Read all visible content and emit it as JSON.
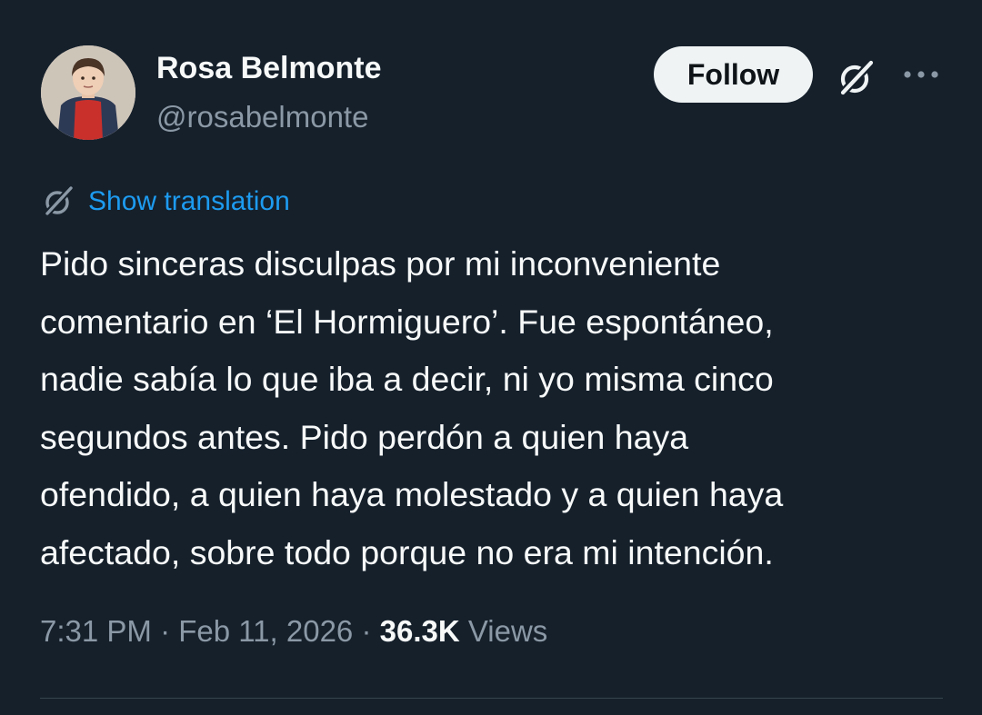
{
  "author": {
    "display_name": "Rosa Belmonte",
    "handle": "@rosabelmonte",
    "avatar_icon": "profile-photo-child-red-sweater"
  },
  "actions": {
    "follow_label": "Follow",
    "grok_icon": "grok-icon",
    "more_icon": "more-horizontal-icon"
  },
  "translation": {
    "icon": "grok-icon",
    "label": "Show translation"
  },
  "tweet": {
    "lines": [
      "Pido sinceras disculpas por mi inconveniente",
      "comentario en ‘El Hormiguero’. Fue espontáneo,",
      "nadie sabía lo que iba a decir, ni yo misma cinco",
      "segundos antes. Pido perdón a quien haya",
      "ofendido, a quien haya molestado y a quien haya",
      "afectado, sobre todo porque no era mi intención."
    ]
  },
  "meta": {
    "time": "7:31 PM",
    "separator": "·",
    "date": "Feb 11, 2026",
    "views_count": "36.3K",
    "views_label": "Views"
  },
  "colors": {
    "background": "#15202b",
    "text_primary": "#f7f9f9",
    "text_secondary": "#8b98a5",
    "link": "#1d9bf0",
    "button_bg": "#eff3f4",
    "divider": "#38444d"
  }
}
